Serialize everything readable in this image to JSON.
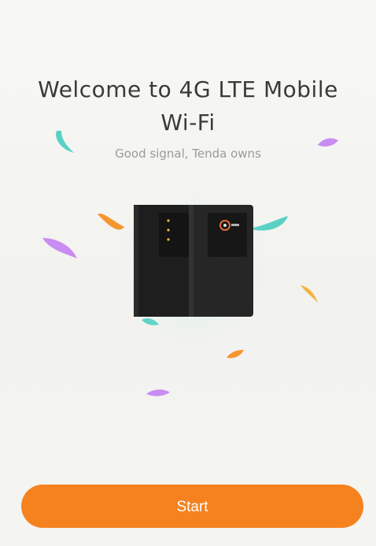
{
  "welcome": {
    "title_line1": "Welcome to 4G LTE Mobile",
    "title_line2": "Wi-Fi",
    "subtitle": "Good signal, Tenda owns"
  },
  "illustration": {
    "name": "mobile-wifi-devices",
    "confetti_colors": [
      "#59d1c4",
      "#c98cf2",
      "#f5962e",
      "#f4b53f"
    ]
  },
  "actions": {
    "start_label": "Start"
  },
  "colors": {
    "accent": "#f6821f",
    "title_text": "#3a3a3a",
    "subtitle_text": "#9a9a9a",
    "background": "#f4f4f2"
  }
}
